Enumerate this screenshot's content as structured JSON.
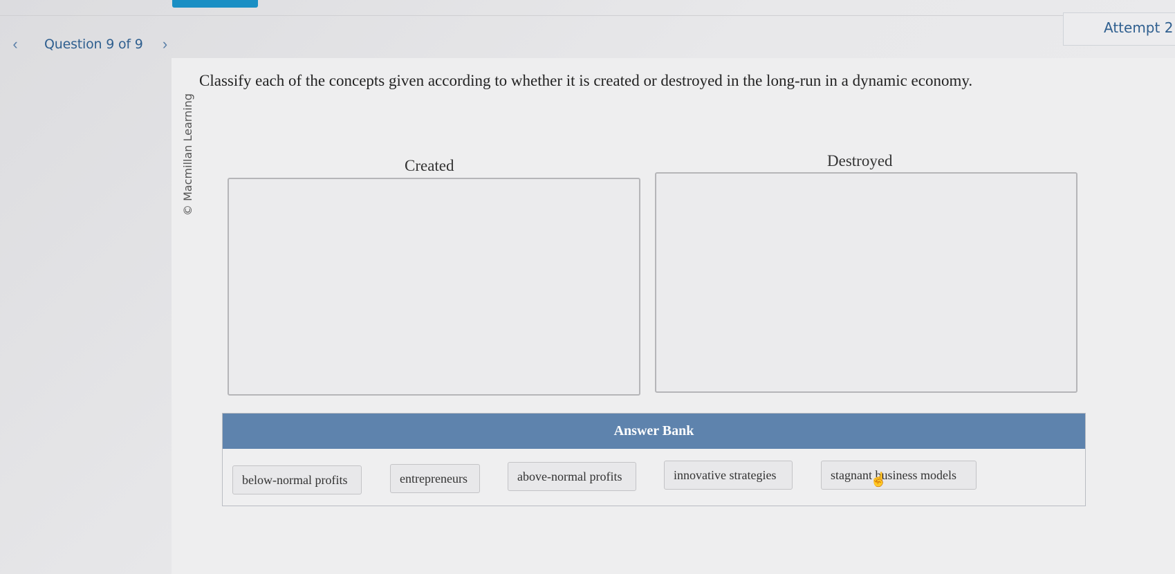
{
  "nav": {
    "prev_icon": "chevron-left-icon",
    "prev_glyph": "‹",
    "question_label": "Question 9 of 9",
    "next_icon": "chevron-right-icon",
    "next_glyph": "›"
  },
  "attempt": {
    "label": "Attempt 2"
  },
  "watermark": "© Macmillan Learning",
  "prompt": "Classify each of the concepts given according to whether it is created or destroyed in the long-run in a dynamic economy.",
  "bins": {
    "created_title": "Created",
    "destroyed_title": "Destroyed"
  },
  "answer_bank": {
    "title": "Answer Bank",
    "items": [
      "below-normal profits",
      "entrepreneurs",
      "above-normal profits",
      "innovative strategies",
      "stagnant business models"
    ]
  },
  "cursor": {
    "icon": "hand-pointer-icon",
    "glyph": "☝"
  },
  "colors": {
    "accent_tab": "#1a8fc4",
    "answer_bank_header": "#5e83ad",
    "nav_text": "#2f5f8f"
  }
}
